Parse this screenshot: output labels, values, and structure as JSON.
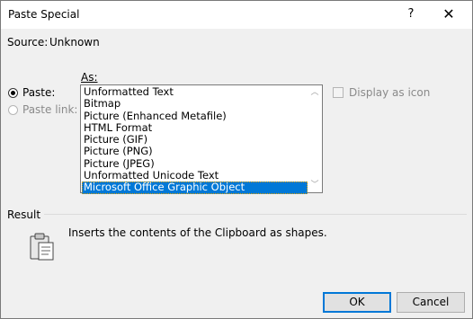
{
  "window": {
    "title": "Paste Special",
    "help_label": "?",
    "close_label": "✕"
  },
  "source": {
    "label": "Source:",
    "value": "Unknown"
  },
  "as_label": "As:",
  "options": {
    "paste_label": "Paste:",
    "paste_link_label": "Paste link:",
    "paste_selected": true
  },
  "formats": [
    "Unformatted Text",
    "Bitmap",
    "Picture (Enhanced Metafile)",
    "HTML Format",
    "Picture (GIF)",
    "Picture (PNG)",
    "Picture (JPEG)",
    "Unformatted Unicode Text",
    "Microsoft Office Graphic Object"
  ],
  "selected_format": "Microsoft Office Graphic Object",
  "display_as_icon": {
    "label": "Display as icon",
    "checked": false
  },
  "result": {
    "label": "Result",
    "description": "Inserts the contents of the Clipboard as shapes."
  },
  "buttons": {
    "ok": "OK",
    "cancel": "Cancel"
  },
  "icons": {
    "help": "help-icon",
    "close": "close-icon",
    "clipboard": "clipboard-icon",
    "scroll_up": "chevron-up-icon",
    "scroll_down": "chevron-down-icon"
  },
  "colors": {
    "selection": "#0078d7",
    "dialog_background": "#f0f0f0"
  }
}
